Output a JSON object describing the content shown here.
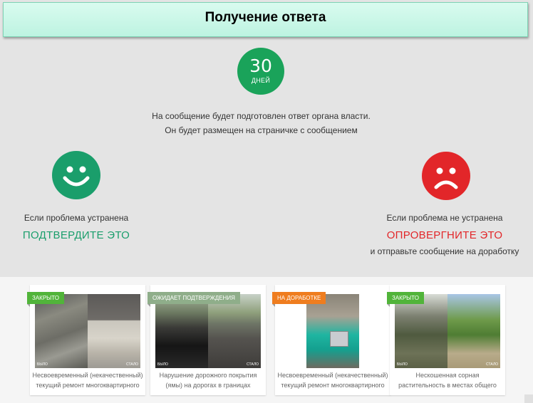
{
  "header": {
    "title": "Получение ответа"
  },
  "days": {
    "number": "30",
    "unit": "ДНЕЙ"
  },
  "info": {
    "line1": "На сообщение будет подготовлен ответ органа власти.",
    "line2": "Он будет размещен на страничке с сообщением"
  },
  "confirm": {
    "icon": "smile-icon",
    "condition": "Если проблема устранена",
    "action": "ПОДТВЕРДИТЕ ЭТО",
    "color": "#1a9e6b"
  },
  "reject": {
    "icon": "frown-icon",
    "condition": "Если проблема не устранена",
    "action": "ОПРОВЕРГНИТЕ ЭТО",
    "note": "и отправьте сообщение на доработку",
    "color": "#e22629"
  },
  "cards": [
    {
      "badge": "ЗАКРЫТО",
      "before": "БЫЛО",
      "after": "СТАЛО",
      "caption": "Несвоевременный (некачественный) текущий ремонт многоквартирного дома"
    },
    {
      "badge": "ОЖИДАЕТ ПОДТВЕРЖДЕНИЯ",
      "before": "БЫЛО",
      "after": "СТАЛО",
      "caption": "Нарушение дорожного покрытия (ямы) на дорогах в границах"
    },
    {
      "badge": "НА ДОРАБОТКЕ",
      "before": "",
      "after": "",
      "caption": "Несвоевременный (некачественный) текущий ремонт многоквартирного дома"
    },
    {
      "badge": "ЗАКРЫТО",
      "before": "БЫЛО",
      "after": "СТАЛО",
      "caption": "Нескошенная сорная растительность в местах общего пользования в"
    }
  ]
}
